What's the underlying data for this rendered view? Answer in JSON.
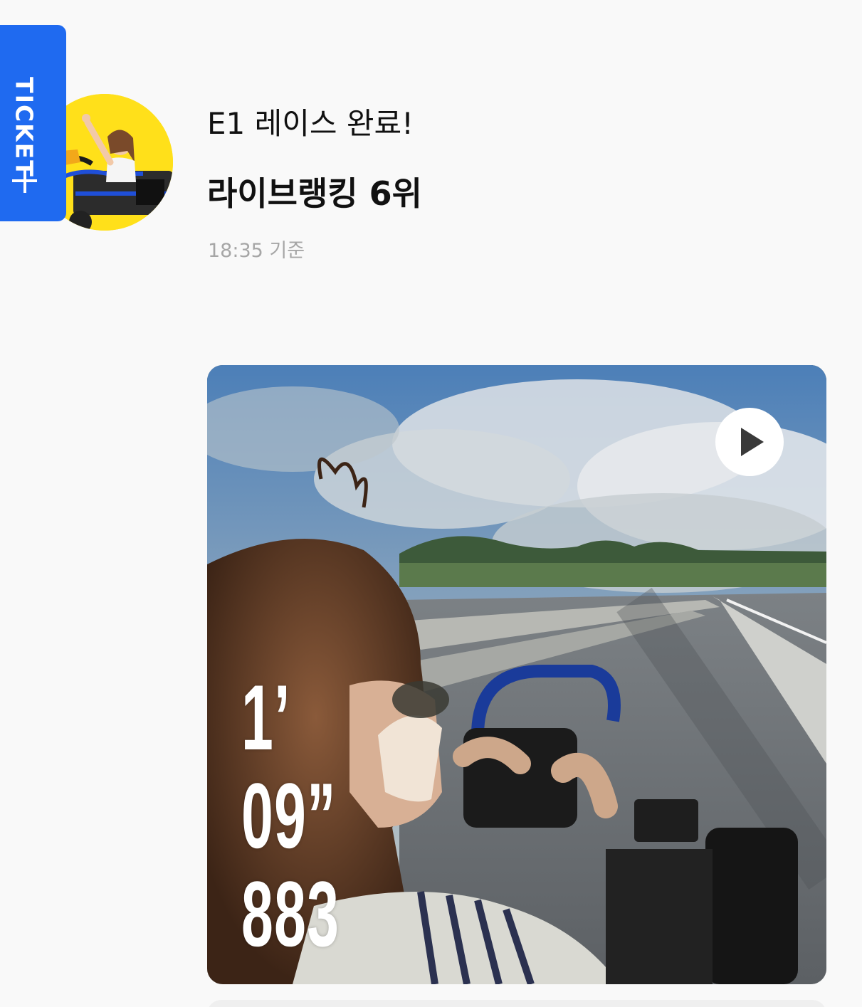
{
  "ticket_tab": {
    "label": "TICKET",
    "color": "#1f6af0"
  },
  "header": {
    "title": "E1 레이스 완료!",
    "ranking": "라이브랭킹 6위",
    "time": "18:35 기준"
  },
  "video": {
    "lap_time": {
      "minutes": "1’",
      "seconds": "09”",
      "millis": "883"
    }
  },
  "icons": {
    "ticket_add": "plus-icon",
    "video_play": "play-icon"
  },
  "colors": {
    "accent": "#1f6af0",
    "avatar_bg": "#ffe01a",
    "muted_text": "#a6a6a6"
  }
}
